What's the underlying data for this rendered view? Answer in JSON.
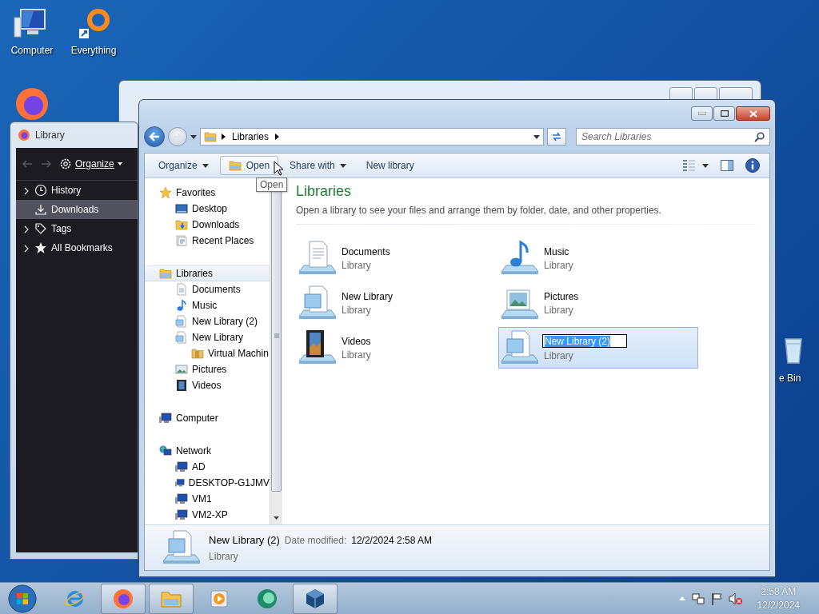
{
  "desktop": {
    "icons": [
      {
        "label": "Computer",
        "kind": "computer"
      },
      {
        "label": "Everything",
        "kind": "everything"
      },
      {
        "label": "e Bin",
        "kind": "recycle"
      }
    ]
  },
  "library_window": {
    "title": "Library",
    "organize": "Organize",
    "items": [
      {
        "label": "History",
        "kind": "history",
        "expandable": true,
        "selected": false
      },
      {
        "label": "Downloads",
        "kind": "downloads",
        "expandable": false,
        "selected": true
      },
      {
        "label": "Tags",
        "kind": "tags",
        "expandable": true,
        "selected": false
      },
      {
        "label": "All Bookmarks",
        "kind": "bookmarks",
        "expandable": true,
        "selected": false
      }
    ]
  },
  "explorer": {
    "breadcrumb": [
      {
        "label": "Libraries"
      }
    ],
    "search": {
      "placeholder": "Search Libraries"
    },
    "toolbar": [
      {
        "label": "Organize",
        "dropdown": true,
        "hovered": false,
        "kind": "text"
      },
      {
        "label": "Open",
        "dropdown": false,
        "hovered": true,
        "kind": "folder"
      },
      {
        "label": "Share with",
        "dropdown": true,
        "hovered": false,
        "kind": "text"
      },
      {
        "label": "New library",
        "dropdown": false,
        "hovered": false,
        "kind": "text"
      }
    ],
    "tooltip": "Open",
    "navigation": [
      {
        "label": "Favorites",
        "kind": "star",
        "selected": false,
        "children": [
          {
            "label": "Desktop",
            "kind": "desktop",
            "selected": false
          },
          {
            "label": "Downloads",
            "kind": "downloads",
            "selected": false
          },
          {
            "label": "Recent Places",
            "kind": "recent",
            "selected": false
          }
        ]
      },
      {
        "label": "Libraries",
        "kind": "libraries",
        "selected": true,
        "children": [
          {
            "label": "Documents",
            "kind": "documents",
            "selected": false
          },
          {
            "label": "Music",
            "kind": "music",
            "selected": false
          },
          {
            "label": "New Library (2)",
            "kind": "library",
            "selected": false
          },
          {
            "label": "New Library",
            "kind": "library",
            "selected": false,
            "children": [
              {
                "label": "Virtual Machin",
                "kind": "folder",
                "selected": false
              }
            ]
          },
          {
            "label": "Pictures",
            "kind": "pictures",
            "selected": false
          },
          {
            "label": "Videos",
            "kind": "videos",
            "selected": false
          }
        ]
      },
      {
        "label": "Computer",
        "kind": "computer",
        "selected": false
      },
      {
        "label": "Network",
        "kind": "network",
        "selected": false,
        "children": [
          {
            "label": "AD",
            "kind": "computer",
            "selected": false
          },
          {
            "label": "DESKTOP-G1JMV",
            "kind": "computer",
            "selected": false
          },
          {
            "label": "VM1",
            "kind": "computer",
            "selected": false
          },
          {
            "label": "VM2-XP",
            "kind": "computer",
            "selected": false
          }
        ]
      }
    ],
    "heading": "Libraries",
    "description": "Open a library to see your files and arrange them by folder, date, and other properties.",
    "libraries": [
      {
        "name": "Documents",
        "type": "Library",
        "kind": "documents",
        "selected": false,
        "renaming": false
      },
      {
        "name": "Music",
        "type": "Library",
        "kind": "music",
        "selected": false,
        "renaming": false
      },
      {
        "name": "New Library",
        "type": "Library",
        "kind": "library",
        "selected": false,
        "renaming": false
      },
      {
        "name": "Pictures",
        "type": "Library",
        "kind": "pictures",
        "selected": false,
        "renaming": false
      },
      {
        "name": "Videos",
        "type": "Library",
        "kind": "videos",
        "selected": false,
        "renaming": false
      },
      {
        "name": "New Library (2)",
        "type": "Library",
        "kind": "library",
        "selected": true,
        "renaming": true
      }
    ],
    "details": {
      "name": "New Library (2)",
      "date_label": "Date modified:",
      "date": "12/2/2024 2:58 AM",
      "type": "Library"
    }
  },
  "taskbar": {
    "buttons": [
      {
        "kind": "ie",
        "active": false
      },
      {
        "kind": "firefox",
        "active": true
      },
      {
        "kind": "explorer",
        "active": true
      },
      {
        "kind": "media",
        "active": false
      },
      {
        "kind": "app",
        "active": false
      },
      {
        "kind": "virtualbox",
        "active": true
      }
    ],
    "clock": {
      "time": "2:58 AM",
      "date": "12/2/2024"
    }
  }
}
